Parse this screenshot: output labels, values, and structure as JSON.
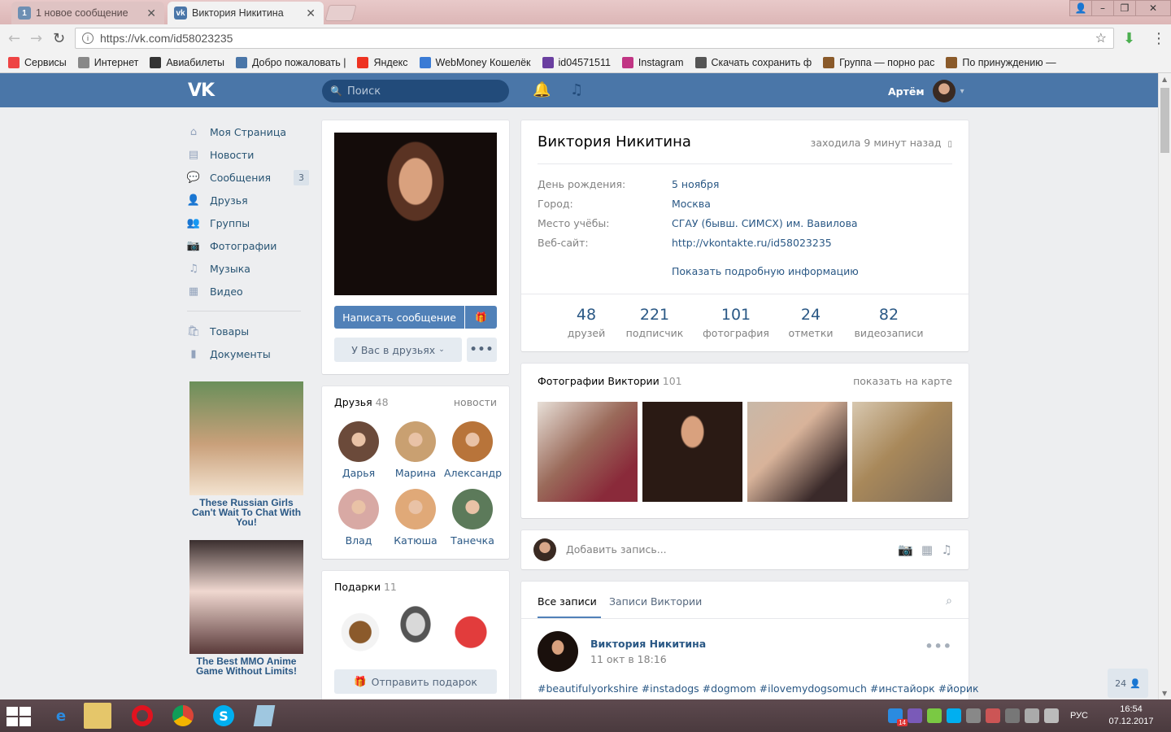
{
  "browser": {
    "tabs": [
      {
        "icon_text": "1",
        "label": "1 новое сообщение",
        "active": false
      },
      {
        "icon_text": "vk",
        "label": "Виктория Никитина",
        "active": true
      }
    ],
    "url": "https://vk.com/id58023235",
    "bookmarks": [
      {
        "icon": "apps-icon",
        "label": "Сервисы",
        "color": "#e44"
      },
      {
        "icon": "page-icon",
        "label": "Интернет",
        "color": "#888"
      },
      {
        "icon": "plane-icon",
        "label": "Авиабилеты",
        "color": "#333"
      },
      {
        "icon": "vk-icon",
        "label": "Добро пожаловать |",
        "color": "#4a76a8"
      },
      {
        "icon": "yandex-icon",
        "label": "Яндекс",
        "color": "#e32"
      },
      {
        "icon": "webmoney-icon",
        "label": "WebMoney Кошелёк",
        "color": "#3a7bd5"
      },
      {
        "icon": "s-icon",
        "label": "id04571511",
        "color": "#6a3fa0"
      },
      {
        "icon": "instagram-icon",
        "label": "Instagram",
        "color": "#c13584"
      },
      {
        "icon": "eye-icon",
        "label": "Скачать сохранить ф",
        "color": "#555"
      },
      {
        "icon": "owl-icon",
        "label": "Группа — порно рас",
        "color": "#8a5a2a"
      },
      {
        "icon": "owl-icon",
        "label": "По принуждению —",
        "color": "#8a5a2a"
      }
    ]
  },
  "vk_header": {
    "logo": "vk",
    "search_placeholder": "Поиск",
    "user_name": "Артём"
  },
  "left_nav": {
    "items": [
      {
        "icon": "home-icon",
        "label": "Моя Страница",
        "count": ""
      },
      {
        "icon": "news-icon",
        "label": "Новости",
        "count": ""
      },
      {
        "icon": "messages-icon",
        "label": "Сообщения",
        "count": "3"
      },
      {
        "icon": "friends-icon",
        "label": "Друзья",
        "count": ""
      },
      {
        "icon": "groups-icon",
        "label": "Группы",
        "count": ""
      },
      {
        "icon": "camera-icon",
        "label": "Фотографии",
        "count": ""
      },
      {
        "icon": "music-icon",
        "label": "Музыка",
        "count": ""
      },
      {
        "icon": "video-icon",
        "label": "Видео",
        "count": ""
      }
    ],
    "items2": [
      {
        "icon": "bag-icon",
        "label": "Товары"
      },
      {
        "icon": "document-icon",
        "label": "Документы"
      }
    ],
    "ads": [
      {
        "text": "These Russian Girls Can't Wait To Chat With You!"
      },
      {
        "text": "The Best MMO Anime Game Without Limits!"
      }
    ]
  },
  "profile_card": {
    "write_message": "Написать сообщение",
    "friend_status": "У Вас в друзьях"
  },
  "friends_block": {
    "title": "Друзья",
    "count": "48",
    "link": "новости",
    "friends": [
      {
        "name": "Дарья",
        "color": "#6b4a3a"
      },
      {
        "name": "Марина",
        "color": "#c9a071"
      },
      {
        "name": "Александр",
        "color": "#b8743a"
      },
      {
        "name": "Влад",
        "color": "#d8a9a4"
      },
      {
        "name": "Катюша",
        "color": "#e0a978"
      },
      {
        "name": "Танечка",
        "color": "#5c7a5a"
      }
    ]
  },
  "gifts_block": {
    "title": "Подарки",
    "count": "11",
    "send_label": "Отправить подарок"
  },
  "profile_info": {
    "name": "Виктория Никитина",
    "online_status": "заходила 9 минут назад",
    "rows": [
      {
        "label": "День рождения:",
        "value": "5 ноября"
      },
      {
        "label": "Город:",
        "value": "Москва"
      },
      {
        "label": "Место учёбы:",
        "value": "СГАУ (бывш. СИМСХ) им. Вавилова"
      },
      {
        "label": "Веб-сайт:",
        "value": "http://vkontakte.ru/id58023235"
      }
    ],
    "show_more": "Показать подробную информацию",
    "counters": [
      {
        "num": "48",
        "label": "друзей"
      },
      {
        "num": "221",
        "label": "подписчик"
      },
      {
        "num": "101",
        "label": "фотография"
      },
      {
        "num": "24",
        "label": "отметки"
      },
      {
        "num": "82",
        "label": "видеозаписи"
      }
    ]
  },
  "photos_block": {
    "title": "Фотографии Виктории",
    "count": "101",
    "link": "показать на карте"
  },
  "composer": {
    "placeholder": "Добавить запись..."
  },
  "wall": {
    "tabs": [
      "Все записи",
      "Записи Виктории"
    ],
    "post": {
      "author": "Виктория Никитина",
      "date": "11 окт в 18:16",
      "text": "#beautifulyorkshire #instadogs #dogmom #ilovemydogsomuch #инстайорк #йорик"
    }
  },
  "online_friends_badge": "24",
  "taskbar": {
    "tray_badge": "14",
    "language": "РУС",
    "time": "16:54",
    "date": "07.12.2017"
  }
}
